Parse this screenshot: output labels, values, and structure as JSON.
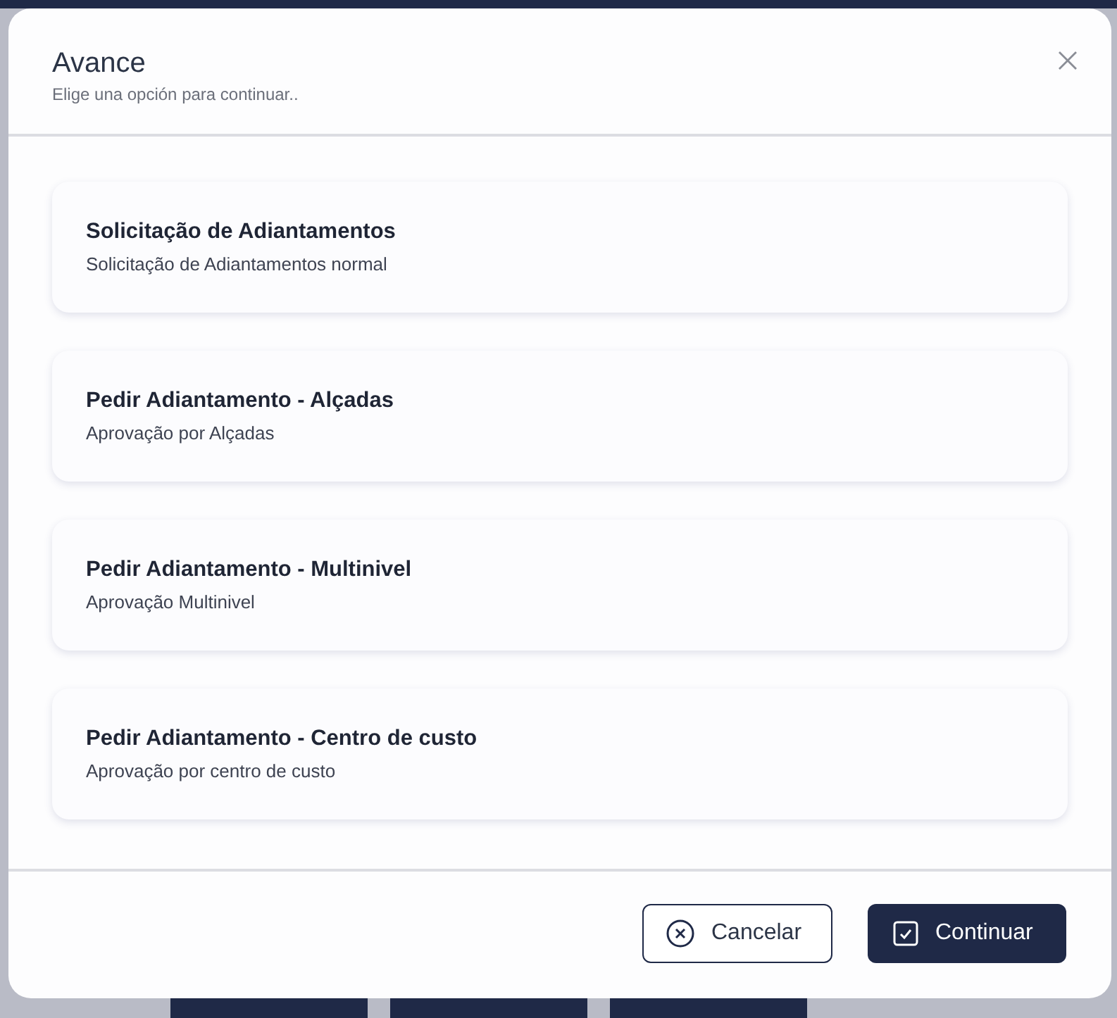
{
  "dialog": {
    "title": "Avance",
    "subtitle": "Elige una opción para continuar.."
  },
  "options": [
    {
      "title": "Solicitação de Adiantamentos",
      "description": "Solicitação de Adiantamentos normal"
    },
    {
      "title": "Pedir Adiantamento - Alçadas",
      "description": "Aprovação por Alçadas"
    },
    {
      "title": "Pedir Adiantamento - Multinivel",
      "description": "Aprovação Multinivel"
    },
    {
      "title": "Pedir Adiantamento - Centro de custo",
      "description": "Aprovação por centro de custo"
    }
  ],
  "buttons": [
    {
      "kind": "cancel",
      "label": "Cancelar"
    },
    {
      "kind": "confirm",
      "label": "Continuar"
    }
  ]
}
